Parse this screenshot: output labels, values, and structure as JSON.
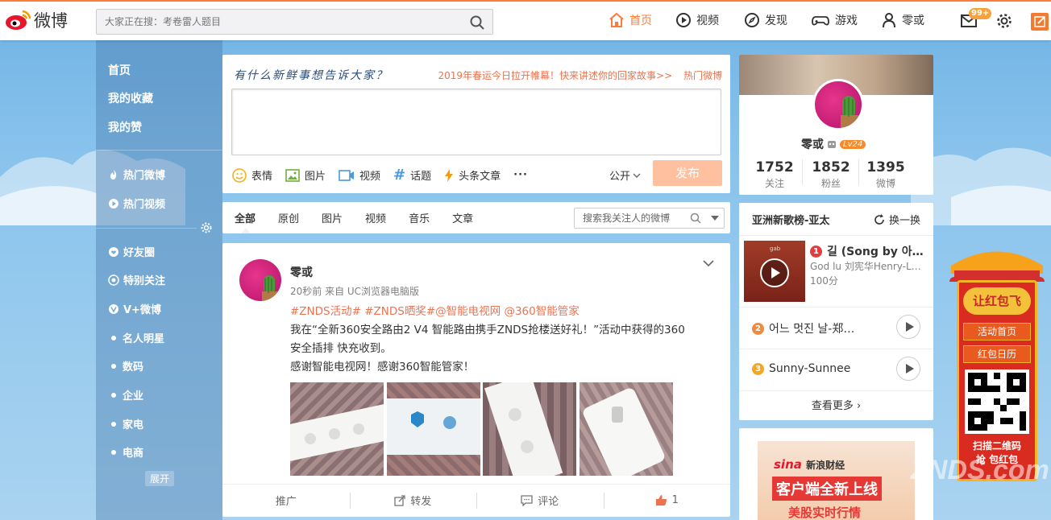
{
  "header": {
    "logo_text": "微博",
    "search_placeholder": "大家正在搜：考卷雷人题目",
    "nav": [
      {
        "label": "首页",
        "icon": "home-icon",
        "active": true
      },
      {
        "label": "视频",
        "icon": "video-icon"
      },
      {
        "label": "发现",
        "icon": "compass-icon"
      },
      {
        "label": "游戏",
        "icon": "gamepad-icon"
      },
      {
        "label": "零或",
        "icon": "user-icon"
      }
    ],
    "message_badge": "99+"
  },
  "sidebar": {
    "top": [
      "首页",
      "我的收藏",
      "我的赞"
    ],
    "hot": [
      "热门微博",
      "热门视频"
    ],
    "groups_icon": [
      "好友圈",
      "特别关注",
      "V+微博"
    ],
    "groups_dot": [
      "名人明星",
      "数码",
      "企业",
      "家电",
      "电商"
    ],
    "expand": "展开"
  },
  "composer": {
    "prompt": "有什么新鲜事想告诉大家？",
    "promo": "2019年春运今日拉开帷幕！快来讲述你的回家故事>>",
    "hot_link": "热门微博",
    "tools": [
      "表情",
      "图片",
      "视频",
      "话题",
      "头条文章"
    ],
    "visibility": "公开",
    "publish": "发布"
  },
  "feed_tabs": {
    "tabs": [
      "全部",
      "原创",
      "图片",
      "视频",
      "音乐",
      "文章"
    ],
    "search_placeholder": "搜索我关注人的微博"
  },
  "post": {
    "author": "零或",
    "meta": "20秒前 来自 UC浏览器电脑版",
    "tags": "#ZNDS活动# #ZNDS晒奖#@智能电视网 @360智能管家",
    "line1": "我在“全新360安全路由2 V4 智能路由携手ZNDS抢楼送好礼！”活动中获得的360",
    "line2": "安全插排 快充收到。",
    "line3": "感谢智能电视网！感谢360智能管家！",
    "actions": [
      "推广",
      "转发",
      "评论",
      "1"
    ]
  },
  "profile": {
    "name": "零或",
    "level": "Lv24",
    "stats": [
      {
        "num": "1752",
        "label": "关注"
      },
      {
        "num": "1852",
        "label": "粉丝"
      },
      {
        "num": "1395",
        "label": "微博"
      }
    ]
  },
  "chart": {
    "title": "亚洲新歌榜-亚太",
    "refresh": "换一换",
    "songs": [
      {
        "rank": "1",
        "title": "길 (Song by 아…",
        "artist": "God lu 刘宪华Henry-L…",
        "score": "100分"
      },
      {
        "rank": "2",
        "title": "어느 멋진 날-郑…"
      },
      {
        "rank": "3",
        "title": "Sunny-Sunnee"
      }
    ],
    "cover_text": "gab",
    "more": "查看更多"
  },
  "ad": {
    "brand": "新浪财经",
    "line1": "客户端全新上线",
    "line2": "美股实时行情"
  },
  "redpacket": {
    "title": "让红包飞",
    "btn1": "活动首页",
    "btn2": "红包日历",
    "scan": "扫描二维码",
    "scan2": "抢 包红包"
  },
  "watermark": "ZNDS.com"
}
